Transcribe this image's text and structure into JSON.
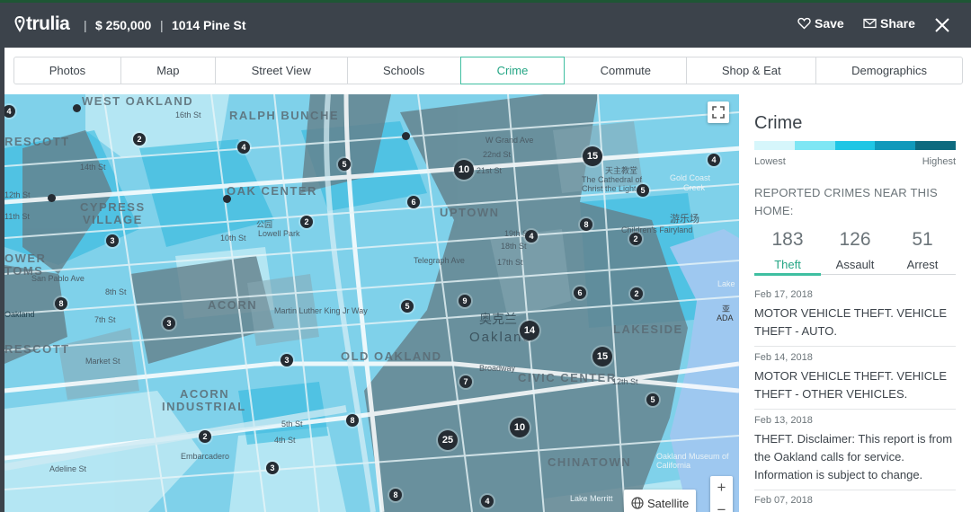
{
  "header": {
    "logo_text": "trulia",
    "separator": "|",
    "price": "$ 250,000",
    "address": "1014 Pine St",
    "save_label": "Save",
    "share_label": "Share"
  },
  "tabs": [
    {
      "label": "Photos",
      "active": false
    },
    {
      "label": "Map",
      "active": false
    },
    {
      "label": "Street View",
      "active": false
    },
    {
      "label": "Schools",
      "active": false
    },
    {
      "label": "Crime",
      "active": true
    },
    {
      "label": "Commute",
      "active": false
    },
    {
      "label": "Shop & Eat",
      "active": false
    },
    {
      "label": "Demographics",
      "active": false
    }
  ],
  "map": {
    "neighborhoods": [
      "WEST OAKLAND",
      "RALPH BUNCHE",
      "RESCOTT",
      "OAK CENTER",
      "CYPRESS",
      "VILLAGE",
      "UPTOWN",
      "OWER",
      "TOMS",
      "ACORN",
      "RESCOTT",
      "OLD OAKLAND",
      "CIVIC CENTER",
      "LAKESIDE",
      "ACORN",
      "INDUSTRIAL",
      "CHINATOWN"
    ],
    "streets": [
      "16th St",
      "14th St",
      "12th St",
      "11th St",
      "10th St",
      "8th St",
      "7th St",
      "W Grand Ave",
      "22nd St",
      "21st St",
      "19th St",
      "18th St",
      "17th St",
      "Broadway",
      "Telegraph Ave",
      "San Pablo Ave",
      "12th St",
      "5th St",
      "4th St",
      "Embarcadero",
      "Adeline St",
      "Market St",
      "Martin Luther King Jr Way"
    ],
    "places": [
      "Lowell Park",
      "公园",
      "Oakland",
      "奥克兰",
      "The Cathedral of Christ the Light",
      "天主教堂",
      "Children's Fairyland",
      "游乐场",
      "Oakland Museum of California",
      "Lake Merritt",
      "Gold Coast",
      "Creek",
      "ADA",
      "亚",
      "Oakland",
      "Lake"
    ],
    "pins": [
      "4",
      "2",
      "4",
      "5",
      "10",
      "15",
      "4",
      "5",
      "6",
      "2",
      "3",
      "4",
      "8",
      "2",
      "8",
      "3",
      "5",
      "9",
      "6",
      "2",
      "14",
      "3",
      "15",
      "7",
      "5",
      "8",
      "10",
      "25",
      "2",
      "3",
      "8",
      "4"
    ],
    "controls": {
      "satellite_label": "Satellite",
      "zoom_in": "+",
      "zoom_out": "−"
    }
  },
  "panel": {
    "title": "Crime",
    "legend": {
      "low_label": "Lowest",
      "high_label": "Highest",
      "colors": [
        "#d6f6fb",
        "#7ee6f4",
        "#1fc6e5",
        "#1099bb",
        "#0d6a7f"
      ]
    },
    "reported_label": "REPORTED CRIMES NEAR THIS HOME:",
    "stats": [
      {
        "value": "183",
        "label": "Theft",
        "active": true
      },
      {
        "value": "126",
        "label": "Assault",
        "active": false
      },
      {
        "value": "51",
        "label": "Arrest",
        "active": false
      }
    ],
    "reports": [
      {
        "date": "Feb 17, 2018",
        "desc": "MOTOR VEHICLE THEFT. VEHICLE THEFT - AUTO."
      },
      {
        "date": "Feb 14, 2018",
        "desc": "MOTOR VEHICLE THEFT. VEHICLE THEFT - OTHER VEHICLES."
      },
      {
        "date": "Feb 13, 2018",
        "desc": "THEFT. Disclaimer: This report is from the Oakland calls for service. Information is subject to change."
      },
      {
        "date": "Feb 07, 2018",
        "desc": ""
      }
    ]
  },
  "colors": {
    "accent": "#3fbfa1",
    "header_bg": "#3c434b",
    "pin": "#252c33"
  }
}
